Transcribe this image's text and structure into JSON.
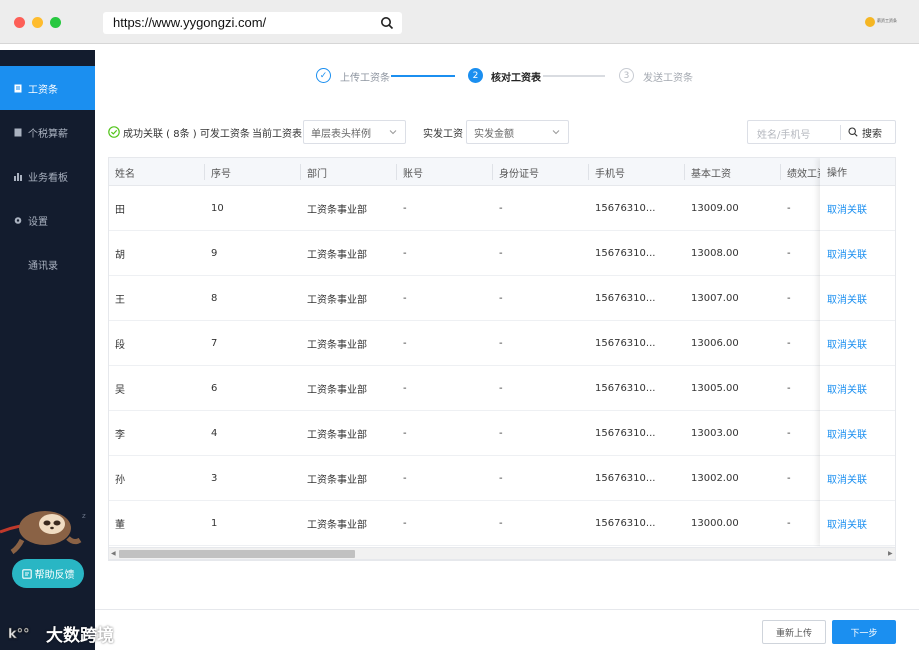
{
  "browser": {
    "url": "https://www.yygongzi.com/",
    "brand_text": "薪资工资条"
  },
  "sidebar": {
    "items": [
      {
        "label": "工资条",
        "icon": "document-icon",
        "active": true
      },
      {
        "label": "个税算薪",
        "icon": "calculator-icon",
        "active": false
      },
      {
        "label": "业务看板",
        "icon": "bar-chart-icon",
        "active": false
      },
      {
        "label": "设置",
        "icon": "gear-icon",
        "active": false
      },
      {
        "label": "通讯录",
        "icon": "",
        "active": false
      }
    ],
    "help_label": "帮助反馈"
  },
  "steps": [
    {
      "number": "✓",
      "label": "上传工资条",
      "state": "done"
    },
    {
      "number": "2",
      "label": "核对工资表",
      "state": "active"
    },
    {
      "number": "3",
      "label": "发送工资条",
      "state": "pending"
    }
  ],
  "toolbar": {
    "status_text": "成功关联 ( 8条 ) 可发工资条",
    "current_label": "当前工资表",
    "current_value": "单层表头样例",
    "actual_label": "实发工资",
    "actual_value": "实发金额",
    "search_placeholder": "姓名/手机号",
    "search_button": "搜索"
  },
  "table": {
    "columns": [
      "姓名",
      "序号",
      "部门",
      "账号",
      "身份证号",
      "手机号",
      "基本工资",
      "绩效工资"
    ],
    "op_header": "操作",
    "op_label": "取消关联",
    "rows": [
      [
        "田",
        "10",
        "工资条事业部",
        "-",
        "-",
        "15676310...",
        "13009.00",
        "-"
      ],
      [
        "胡",
        "9",
        "工资条事业部",
        "-",
        "-",
        "15676310...",
        "13008.00",
        "-"
      ],
      [
        "王",
        "8",
        "工资条事业部",
        "-",
        "-",
        "15676310...",
        "13007.00",
        "-"
      ],
      [
        "段",
        "7",
        "工资条事业部",
        "-",
        "-",
        "15676310...",
        "13006.00",
        "-"
      ],
      [
        "吴",
        "6",
        "工资条事业部",
        "-",
        "-",
        "15676310...",
        "13005.00",
        "-"
      ],
      [
        "李",
        "4",
        "工资条事业部",
        "-",
        "-",
        "15676310...",
        "13003.00",
        "-"
      ],
      [
        "孙",
        "3",
        "工资条事业部",
        "-",
        "-",
        "15676310...",
        "13002.00",
        "-"
      ],
      [
        "董",
        "1",
        "工资条事业部",
        "-",
        "-",
        "15676310...",
        "13000.00",
        "-"
      ]
    ]
  },
  "footer": {
    "reupload_label": "重新上传",
    "next_label": "下一步"
  },
  "watermark": {
    "text": "大数跨境"
  },
  "colors": {
    "accent": "#1b8ff0",
    "sidebar_bg": "#131c2e",
    "help_btn": "#29b6c4",
    "success": "#52c41a"
  }
}
